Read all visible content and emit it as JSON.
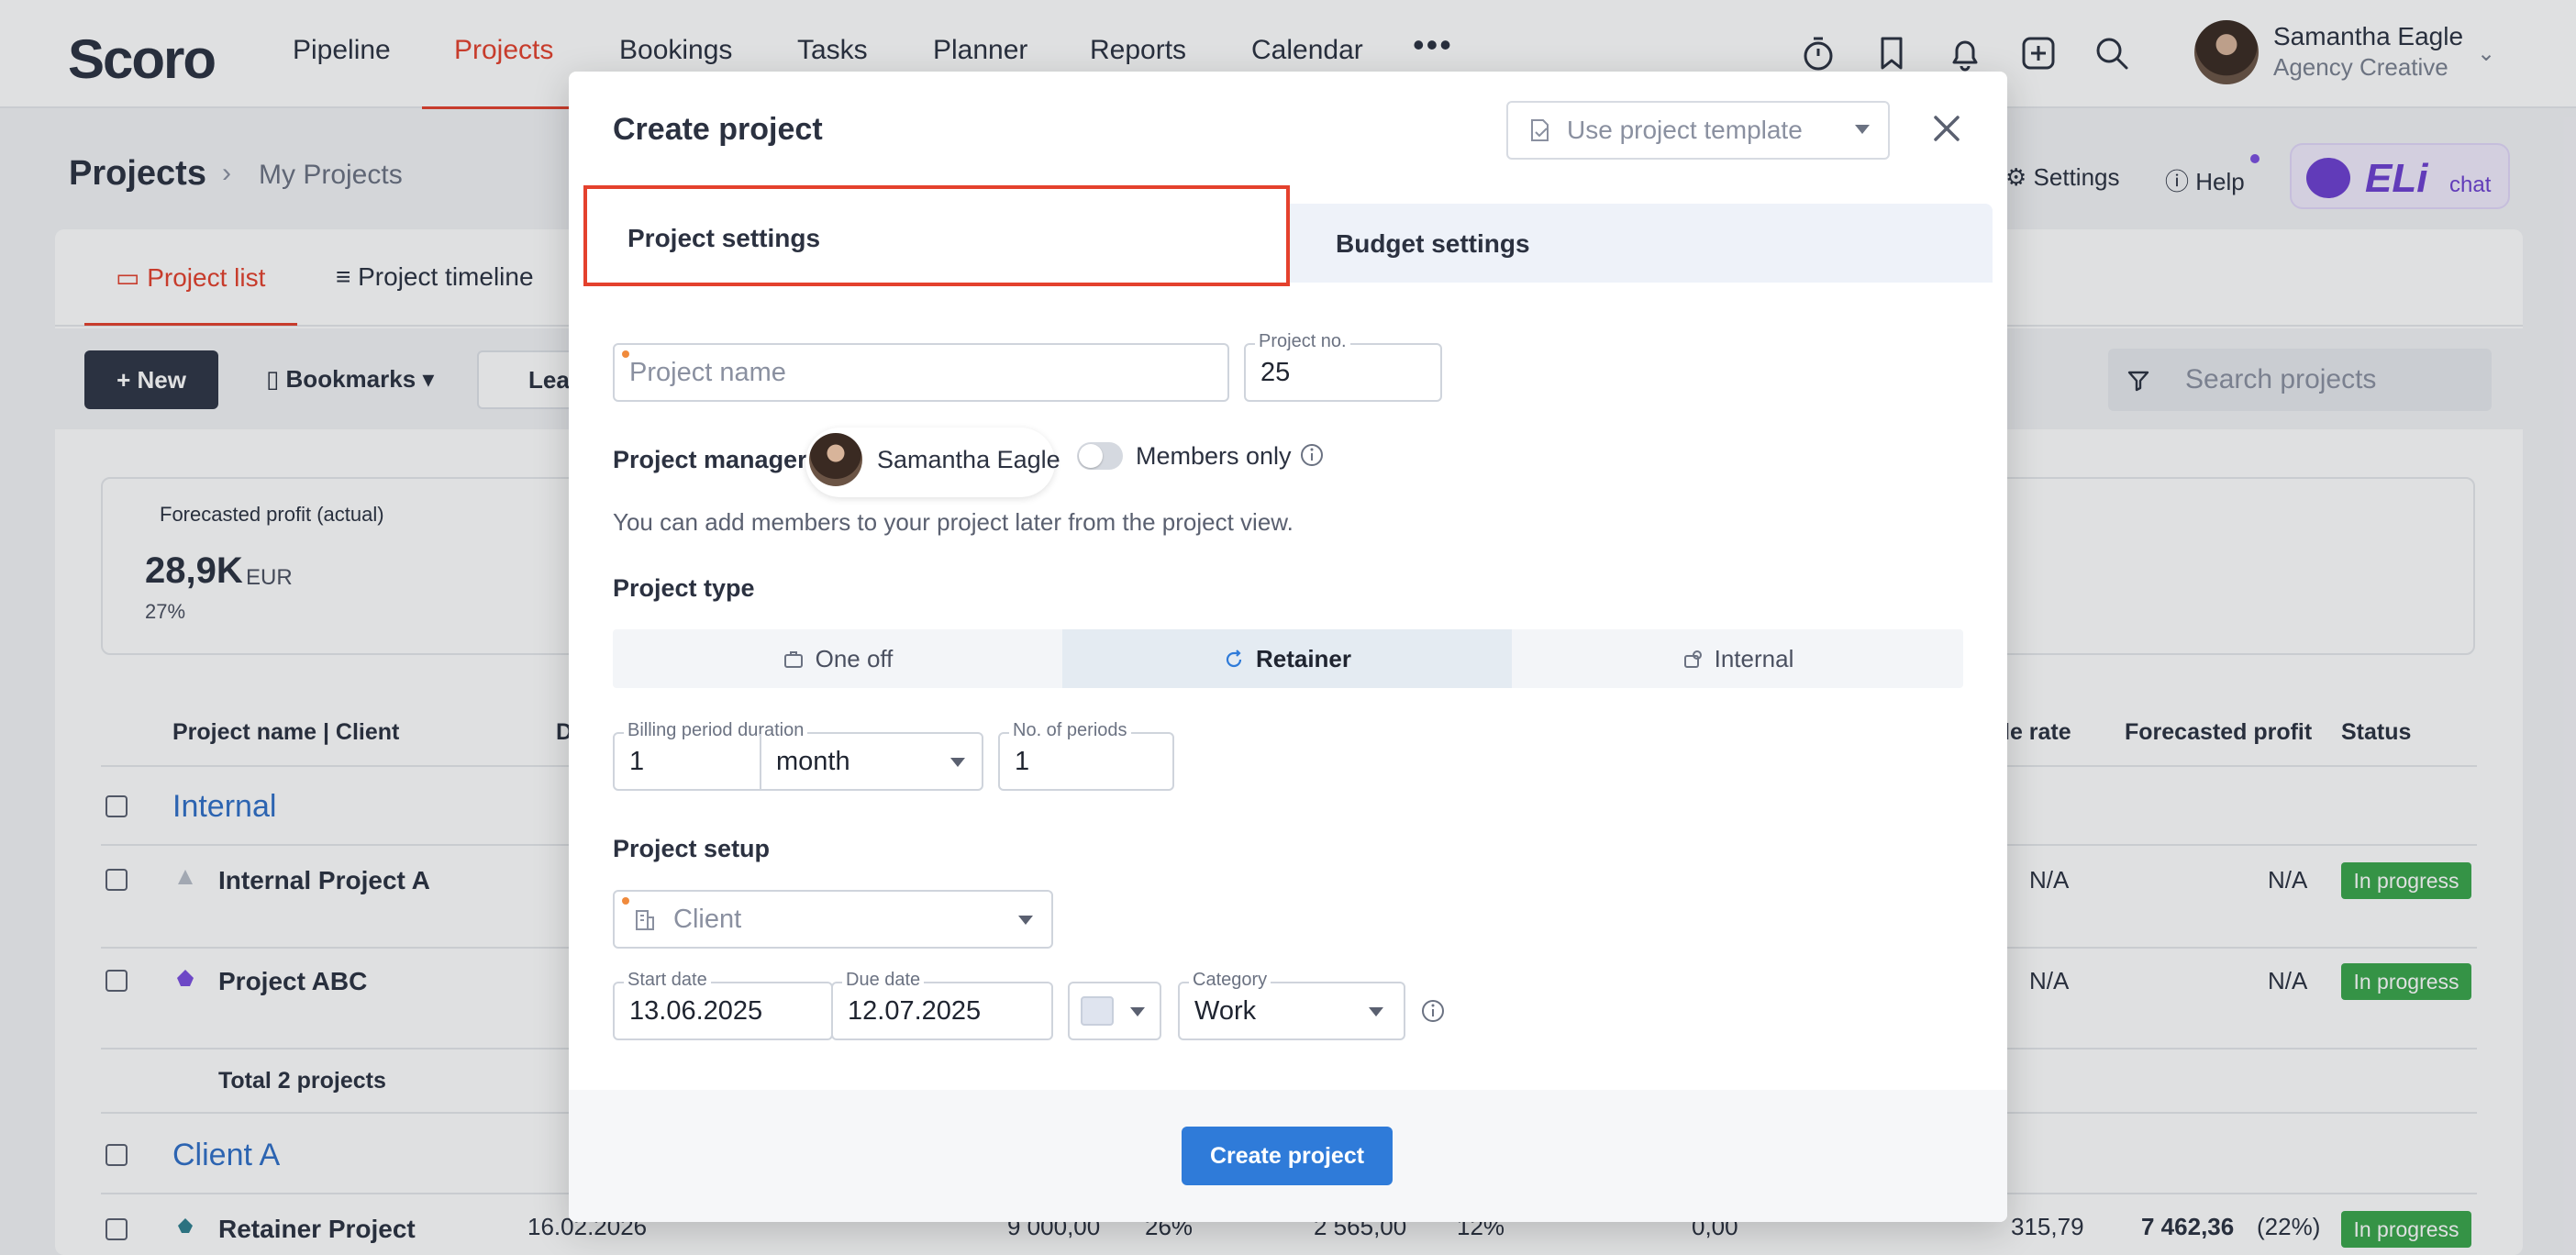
{
  "app": {
    "logo": "Scoro"
  },
  "nav": {
    "items": [
      "Pipeline",
      "Projects",
      "Bookings",
      "Tasks",
      "Planner",
      "Reports",
      "Calendar"
    ],
    "more": "•••",
    "active": "Projects"
  },
  "user": {
    "name": "Samantha Eagle",
    "role": "Agency Creative"
  },
  "header": {
    "title": "Projects",
    "breadcrumb": "My Projects",
    "settings": "Settings",
    "help": "Help",
    "eli_logo": "ELi",
    "eli_chat": "chat"
  },
  "page_tabs": [
    "Project list",
    "Project timeline"
  ],
  "toolbar": {
    "new": "+ New",
    "bookmarks": "Bookmarks",
    "lead": "Lea",
    "search_placeholder": "Search projects"
  },
  "kpi": {
    "label": "Forecasted profit (actual)",
    "value": "28,9K",
    "unit": "EUR",
    "pct": "27%"
  },
  "table": {
    "headers": {
      "name": "Project name | Client",
      "d": "D",
      "rate": "le rate",
      "profit": "Forecasted profit",
      "status": "Status"
    },
    "groups": [
      {
        "title": "Internal",
        "rows": [
          {
            "name": "Internal Project A",
            "rate": "N/A",
            "profit": "N/A",
            "status": "In progress"
          },
          {
            "name": "Project ABC",
            "rate": "N/A",
            "profit": "N/A",
            "status": "In progress"
          }
        ],
        "total": "Total 2 projects"
      },
      {
        "title": "Client A",
        "rows": [
          {
            "name": "Retainer Project",
            "date": "16.02.2026",
            "budget": "9 000,00",
            "budget_pct": "26%",
            "spent": "2 565,00",
            "spent_pct": "12%",
            "extra": "0,00",
            "rate": "315,79",
            "profit": "7 462,36",
            "profit_pct": "(22%)",
            "status": "In progress"
          }
        ]
      }
    ]
  },
  "modal": {
    "title": "Create project",
    "template_placeholder": "Use project template",
    "tabs": {
      "project_settings": "Project settings",
      "budget_settings": "Budget settings"
    },
    "project_name_placeholder": "Project name",
    "project_no_label": "Project no.",
    "project_no": "25",
    "project_manager_label": "Project manager",
    "project_manager": "Samantha Eagle",
    "members_only": "Members only",
    "members_hint": "You can add members to your project later from the project view.",
    "project_type_label": "Project type",
    "project_types": [
      "One off",
      "Retainer",
      "Internal"
    ],
    "selected_type": "Retainer",
    "billing_period_label": "Billing period duration",
    "billing_period_value": "1",
    "billing_period_unit": "month",
    "periods_label": "No. of periods",
    "periods_value": "1",
    "project_setup_label": "Project setup",
    "client_placeholder": "Client",
    "start_date_label": "Start date",
    "start_date": "13.06.2025",
    "due_date_label": "Due date",
    "due_date": "12.07.2025",
    "category_label": "Category",
    "category": "Work",
    "create_button": "Create project"
  },
  "colors": {
    "accent_red": "#e4412d",
    "primary_blue": "#2f7bd9",
    "status_green": "#3aa64b",
    "link_blue": "#2f6fc8"
  }
}
